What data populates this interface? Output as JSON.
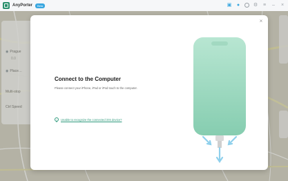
{
  "app": {
    "name": "AnyPorter",
    "badge": "Beta"
  },
  "titlebar_icons": [
    "cart-icon",
    "user-icon",
    "refresh-icon",
    "settings-icon",
    "menu-icon",
    "minimize-icon",
    "close-icon"
  ],
  "side_panel": {
    "item1": "Prague",
    "item2": "0.0",
    "item3": "Place…",
    "label1": "Multi-stop",
    "label2": "Ctrl Speed"
  },
  "modal": {
    "title": "Connect to the Computer",
    "description": "Please connect your iPhone, iPad or iPod touch to the computer.",
    "help_link": "Unable to recognize the connected iOS device?",
    "close_label": "×"
  },
  "colors": {
    "accent": "#2e9a7c",
    "phone": "#a9dcc6",
    "arrows": "#8fd0ec"
  }
}
